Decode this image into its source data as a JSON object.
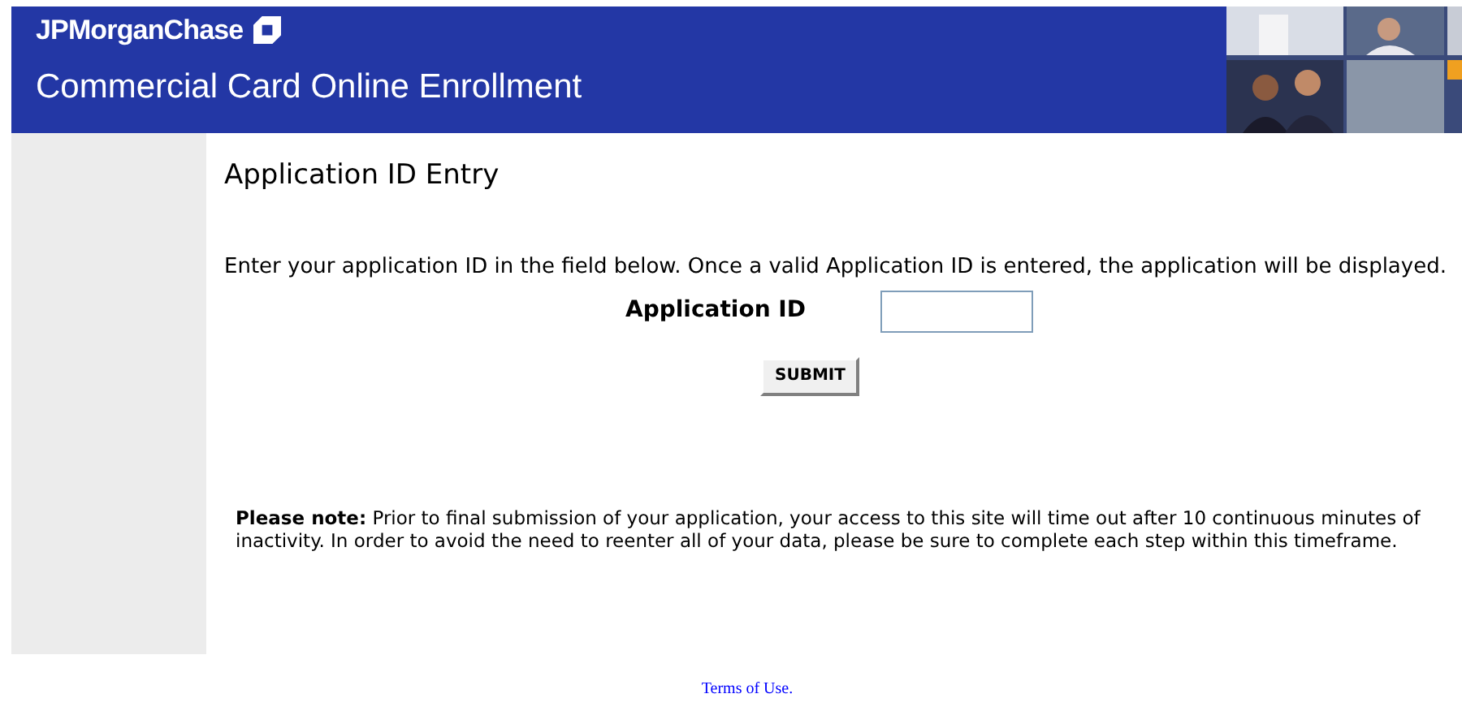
{
  "header": {
    "logo": "JPMorganChase",
    "title": "Commercial Card Online Enrollment"
  },
  "page_title": "Application ID Entry",
  "intro": "Enter your application ID in the field below. Once a valid Application ID is entered, the application will be displayed.",
  "field": {
    "label": "Application ID"
  },
  "submit": "SUBMIT",
  "note": "**Please note:** Prior to final submission of your application, your access to this site will time out after 10 continuous minutes of inactivity. In order to avoid the need to reenter all of your data, please be sure to complete each step within this timeframe.",
  "footer_link": "Terms of Use."
}
